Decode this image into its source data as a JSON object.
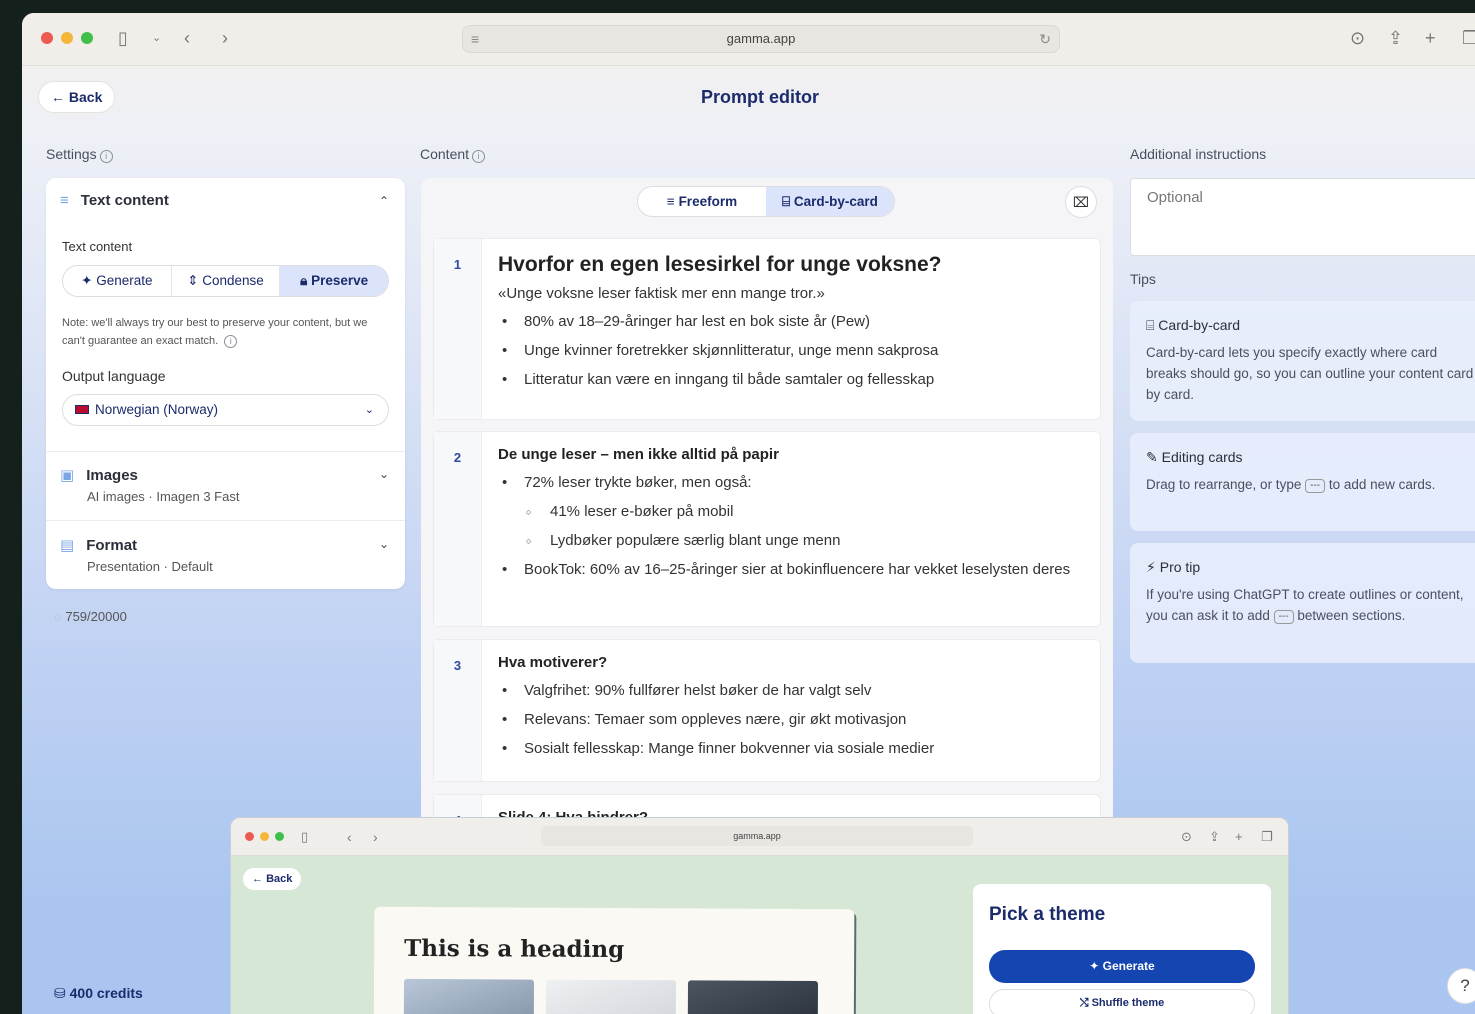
{
  "browser": {
    "url": "gamma.app"
  },
  "header": {
    "back_label": "Back",
    "title": "Prompt editor"
  },
  "settings": {
    "label": "Settings",
    "text_content": {
      "title": "Text content",
      "label": "Text content",
      "modes": [
        "Generate",
        "Condense",
        "Preserve"
      ],
      "active_mode": "Preserve",
      "note": "Note: we'll always try our best to preserve your content, but we can't guarantee an exact match.",
      "output_language_label": "Output language",
      "output_language_value": "Norwegian (Norway)"
    },
    "images": {
      "title": "Images",
      "subtitle": "AI images · Imagen 3 Fast"
    },
    "format": {
      "title": "Format",
      "subtitle": "Presentation · Default"
    },
    "counter": "759/20000"
  },
  "content": {
    "label": "Content",
    "tabs": [
      "Freeform",
      "Card-by-card"
    ],
    "active_tab": "Card-by-card",
    "cards": [
      {
        "num": "1",
        "title": "Hvorfor en egen lesesirkel for unge voksne?",
        "quote": "«Unge voksne leser faktisk mer enn mange tror.»",
        "bullets": [
          "80% av 18–29-åringer har lest en bok siste år (Pew)",
          "Unge kvinner foretrekker skjønnlitteratur, unge menn sakprosa",
          "Litteratur kan være en inngang til både samtaler og fellesskap"
        ]
      },
      {
        "num": "2",
        "title": "De unge leser – men ikke alltid på papir",
        "bullets": [
          "72% leser trykte bøker, men også:",
          "41% leser e-bøker på mobil",
          "Lydbøker populære særlig blant unge menn",
          "BookTok: 60% av 16–25-åringer sier at bokinfluencere har vekket leselysten deres"
        ]
      },
      {
        "num": "3",
        "title": "Hva motiverer?",
        "bullets": [
          "Valgfrihet: 90% fullfører helst bøker de har valgt selv",
          "Relevans: Temaer som oppleves nære, gir økt motivasjon",
          "Sosialt fellesskap: Mange finner bokvenner via sosiale medier"
        ]
      },
      {
        "num": "4",
        "title": "Slide 4: Hva hindrer?"
      }
    ]
  },
  "instructions": {
    "label": "Additional instructions",
    "placeholder": "Optional",
    "tips_label": "Tips",
    "tips": [
      {
        "icon": "card-icon",
        "title": "Card-by-card",
        "body": "Card-by-card lets you specify exactly where card breaks should go, so you can outline your content card by card."
      },
      {
        "icon": "edit-icon",
        "title": "Editing cards",
        "body_before": "Drag to rearrange, or type",
        "kbd": "---",
        "body_after": "to add new cards."
      },
      {
        "icon": "bolt-icon",
        "title": "Pro tip",
        "body_before": "If you're using ChatGPT to create outlines or content, you can ask it to add",
        "kbd": "---",
        "body_after": "between sections."
      }
    ]
  },
  "footer": {
    "credits": "400 credits",
    "help": "?"
  },
  "overlay": {
    "url": "gamma.app",
    "back_label": "Back",
    "slide_heading": "This is a heading",
    "theme_title": "Pick a theme",
    "generate_label": "Generate",
    "shuffle_label": "Shuffle theme"
  },
  "colors": {
    "accent": "#1b2b6b",
    "primary_button": "#1545b0",
    "active_segment": "#dbe4fb"
  }
}
